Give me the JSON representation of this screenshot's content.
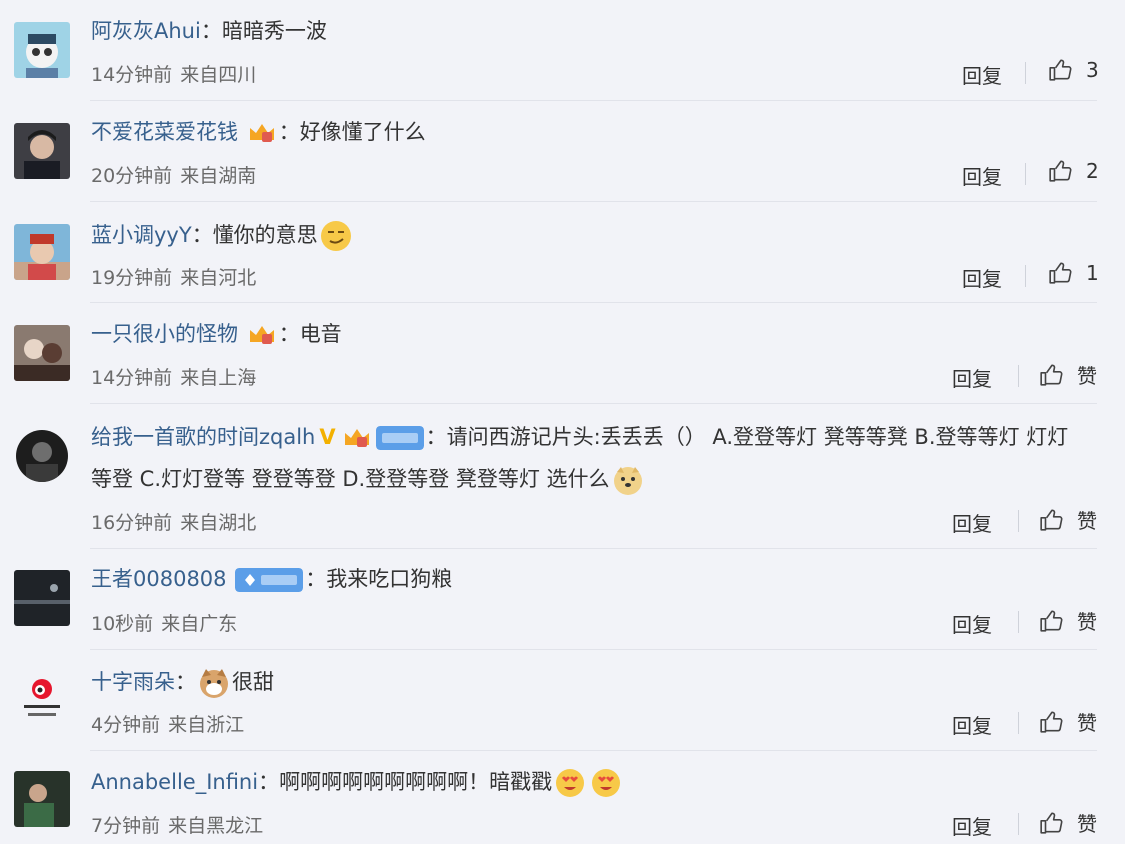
{
  "comments": [
    {
      "user": "阿灰灰Ahui",
      "colon": "：",
      "text": "暗暗秀一波",
      "time": "14分钟前",
      "location": "来自四川",
      "reply": "回复",
      "likes": "3"
    },
    {
      "user": "不爱花菜爱花钱",
      "colon": "：",
      "text": "好像懂了什么",
      "time": "20分钟前",
      "location": "来自湖南",
      "reply": "回复",
      "likes": "2"
    },
    {
      "user": "蓝小调yyY",
      "colon": "：",
      "text": "懂你的意思",
      "time": "19分钟前",
      "location": "来自河北",
      "reply": "回复",
      "likes": "1"
    },
    {
      "user": "一只很小的怪物",
      "colon": "：",
      "text": "电音",
      "time": "14分钟前",
      "location": "来自上海",
      "reply": "回复",
      "likes": "赞"
    },
    {
      "user": "给我一首歌的时间zqalh",
      "colon": "：",
      "text_a": "请问西游记片头:丢丢丢（）  A.登登等灯  凳等等凳  B.登等等灯  灯灯等登  C.灯灯登等  登登等登  D.登登等登  凳登等灯  选什么",
      "time": "16分钟前",
      "location": "来自湖北",
      "reply": "回复",
      "likes": "赞"
    },
    {
      "user": "王者0080808",
      "colon": "：",
      "text": "我来吃口狗粮",
      "time": "10秒前",
      "location": "来自广东",
      "reply": "回复",
      "likes": "赞"
    },
    {
      "user": "十字雨朵",
      "colon": "：",
      "text": "很甜",
      "time": "4分钟前",
      "location": "来自浙江",
      "reply": "回复",
      "likes": "赞"
    },
    {
      "user": "Annabelle_Infini",
      "colon": "：",
      "text": "啊啊啊啊啊啊啊啊啊！暗戳戳",
      "time": "7分钟前",
      "location": "来自黑龙江",
      "reply": "回复",
      "likes": "赞"
    }
  ],
  "colors": {
    "username": "#37608d",
    "text": "#333333",
    "meta": "#6a6a6a",
    "background": "#f2f3f8",
    "vip": "#f3b100",
    "badge": "#4a90e2"
  }
}
